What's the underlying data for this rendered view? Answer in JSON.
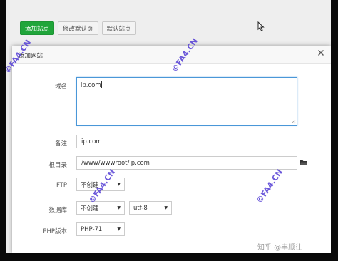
{
  "toolbar": {
    "add_site": "添加站点",
    "modify_default_page": "修改默认页",
    "default_site": "默认站点"
  },
  "dialog": {
    "title": "添加网站",
    "domain_label": "域名",
    "domain_value": "ip.com",
    "note_label": "备注",
    "note_value": "ip.com",
    "root_label": "根目录",
    "root_value": "/www/wwwroot/ip.com",
    "ftp_label": "FTP",
    "ftp_value": "不创建",
    "db_label": "数据库",
    "db_value": "不创建",
    "db_charset": "utf-8",
    "php_label": "PHP版本",
    "php_value": "PHP-71"
  },
  "watermark": {
    "text": "©FA4.CN",
    "color": "#5b46d6"
  },
  "footer": {
    "zhihu_credit": "知乎 @丰顺往"
  },
  "colors": {
    "accent_green": "#20a53a",
    "focus_blue": "#4a97d8"
  },
  "icons": {
    "close": "close-icon",
    "folder": "folder-icon",
    "cursor": "mouse-cursor-icon"
  }
}
